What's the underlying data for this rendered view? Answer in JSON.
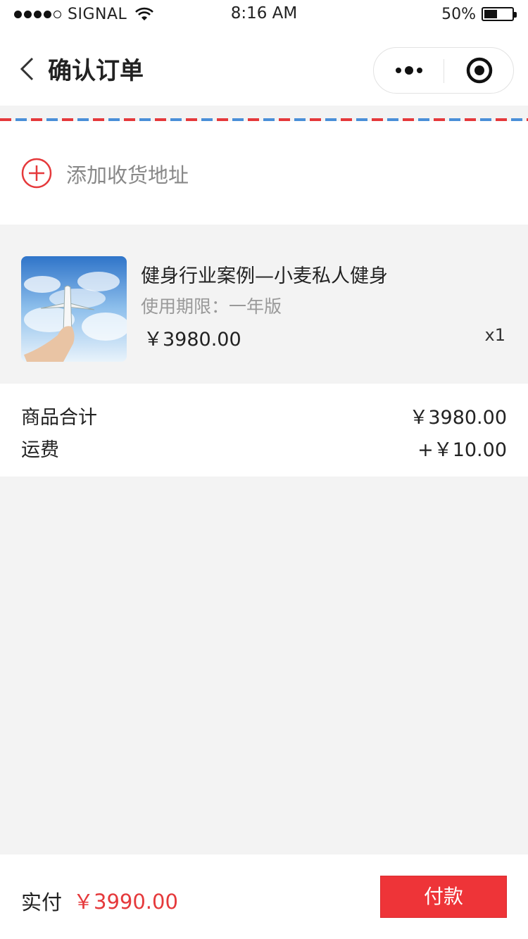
{
  "status_bar": {
    "carrier": "SIGNAL",
    "time": "8:16 AM",
    "battery": "50%"
  },
  "nav": {
    "title": "确认订单",
    "icons": [
      "back-icon",
      "more-icon",
      "close-target-icon"
    ]
  },
  "address": {
    "add_label": "添加收货地址",
    "icon": "plus-circle-icon"
  },
  "product": {
    "name": "健身行业案例—小麦私人健身",
    "spec": "使用期限：一年版",
    "price": "￥3980.00",
    "quantity": "x1"
  },
  "summary": {
    "subtotal_label": "商品合计",
    "subtotal_value": "￥3980.00",
    "shipping_label": "运费",
    "shipping_value": "+￥10.00"
  },
  "checkout": {
    "total_label": "实付",
    "total_value": "￥3990.00",
    "pay_button": "付款"
  },
  "colors": {
    "accent": "#e5393b",
    "stripe_blue": "#4a8fd8"
  }
}
